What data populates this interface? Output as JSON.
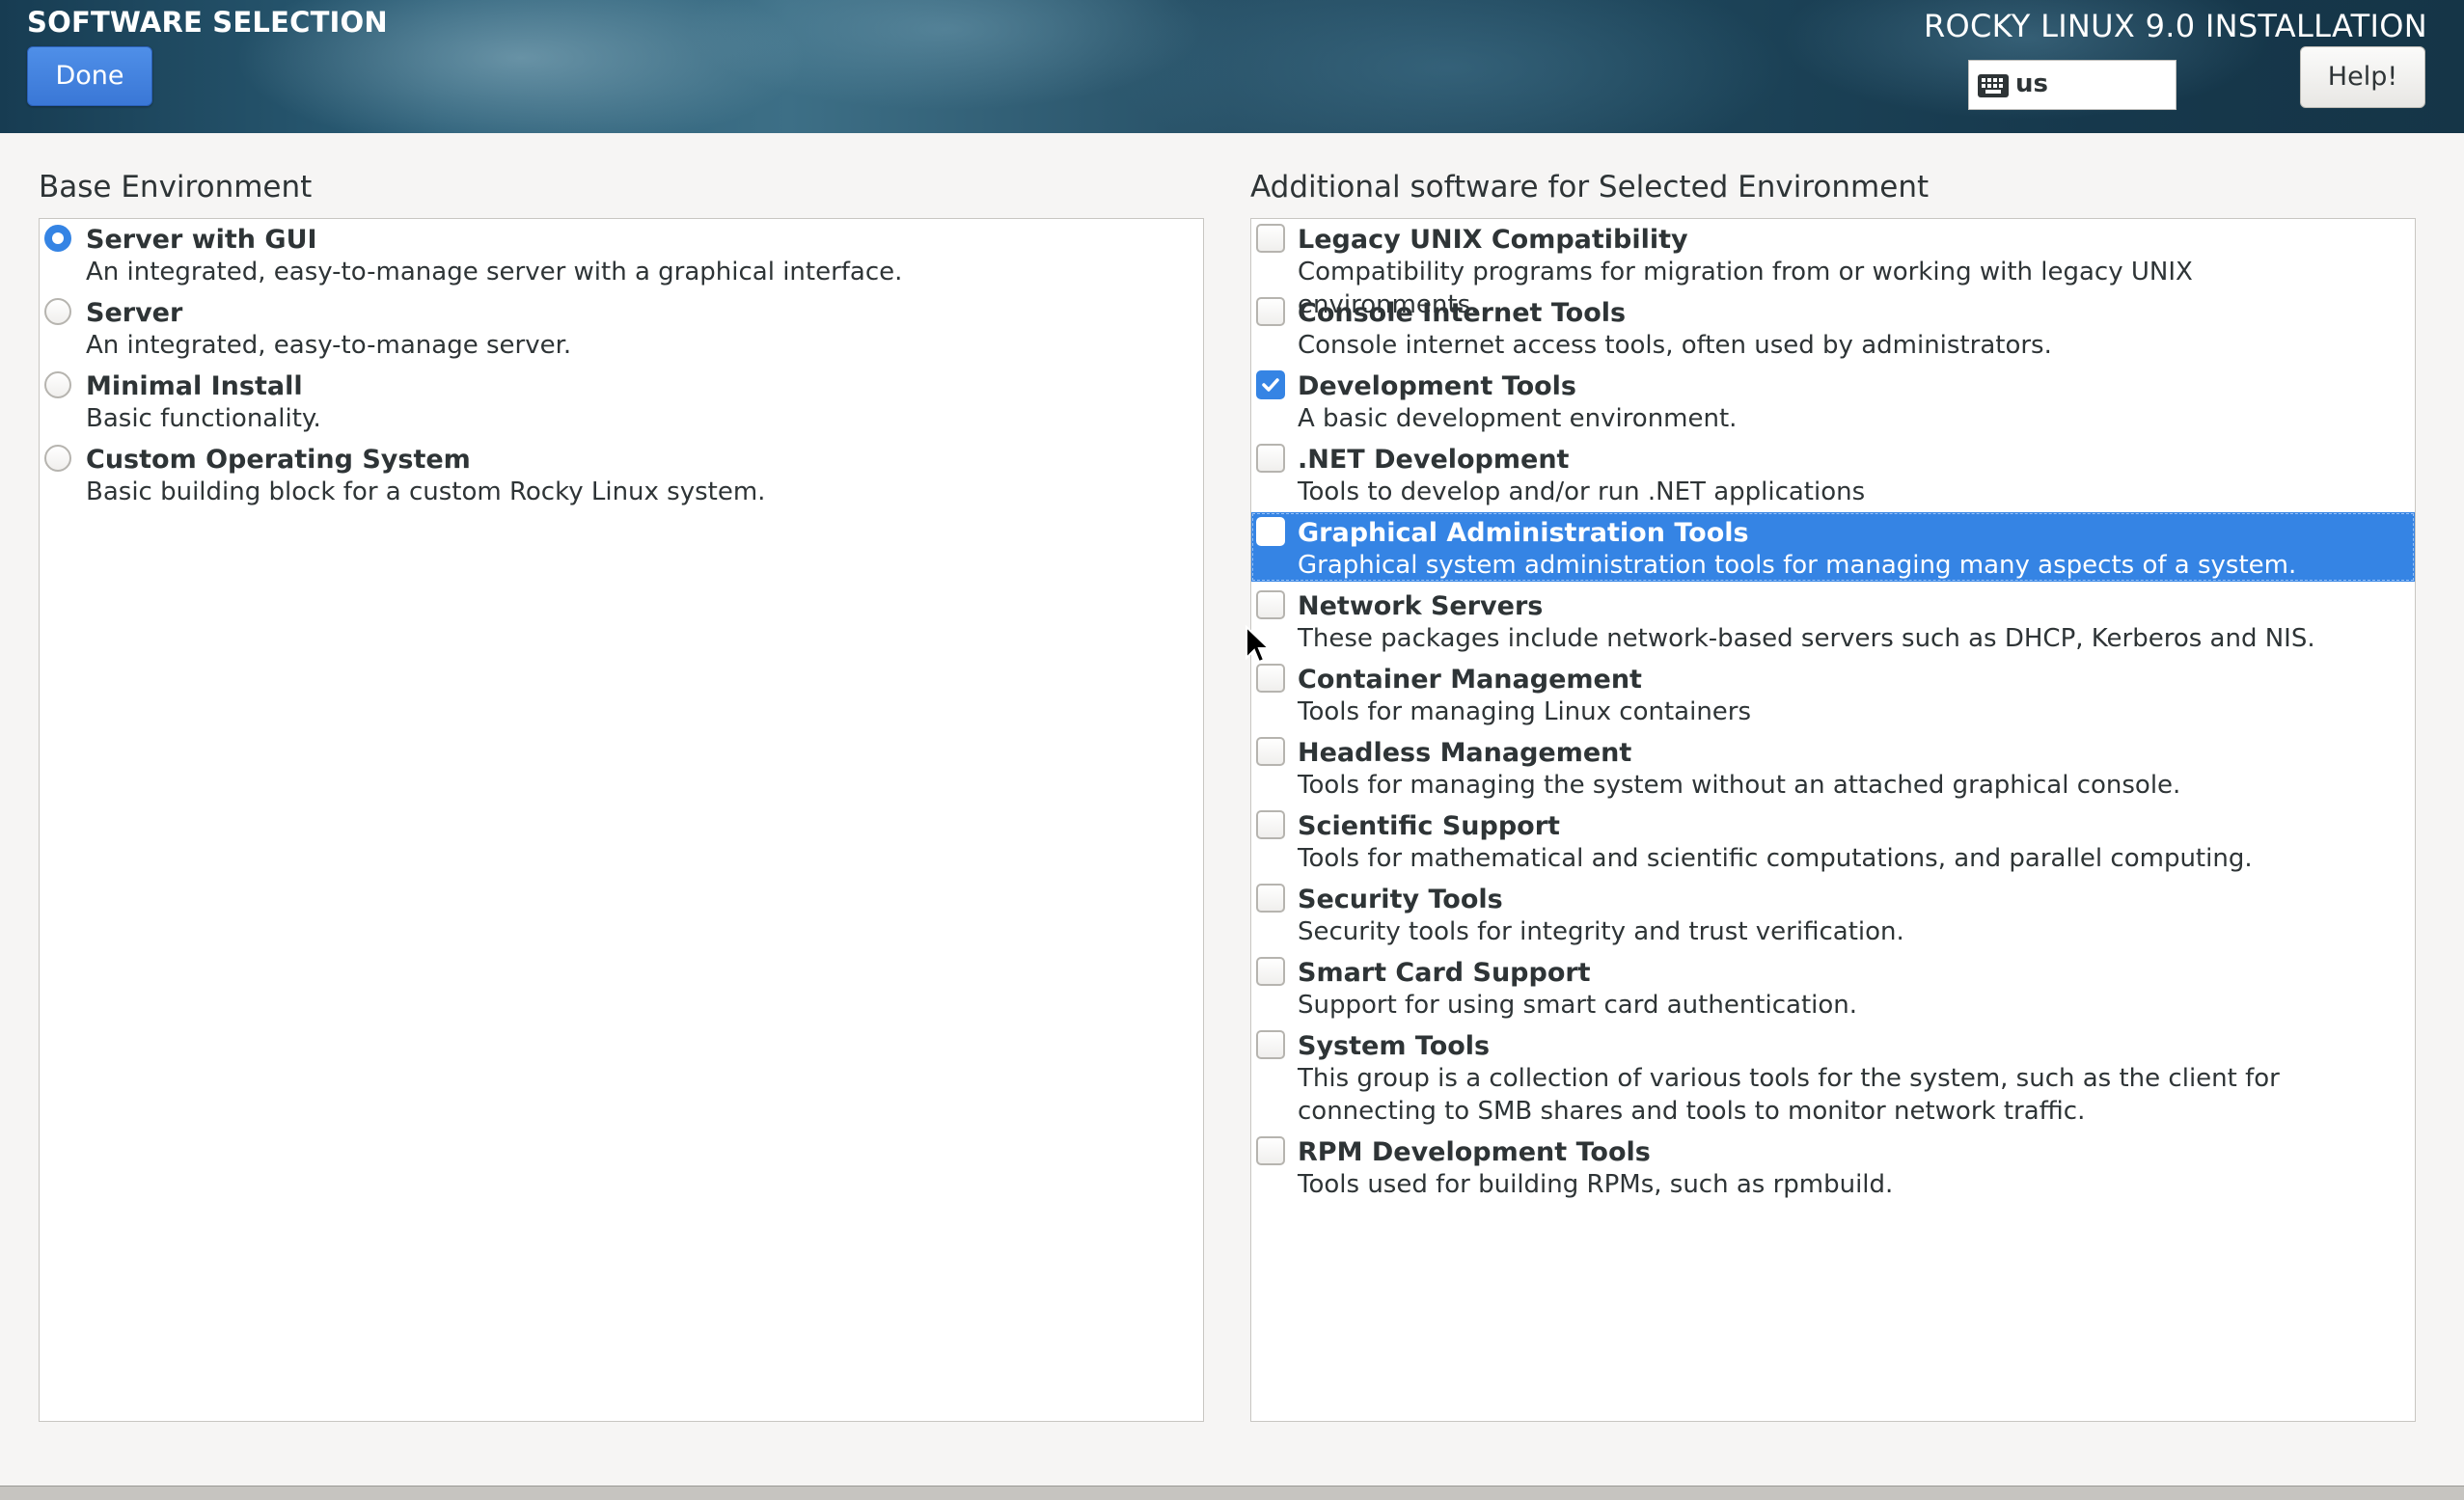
{
  "header": {
    "title": "SOFTWARE SELECTION",
    "done_label": "Done",
    "product": "ROCKY LINUX 9.0 INSTALLATION",
    "keyboard_layout": "us",
    "keyboard_icon": "keyboard-icon",
    "help_label": "Help!"
  },
  "base": {
    "heading": "Base Environment",
    "items": [
      {
        "name": "Server with GUI",
        "desc": "An integrated, easy-to-manage server with a graphical interface.",
        "selected": true
      },
      {
        "name": "Server",
        "desc": "An integrated, easy-to-manage server.",
        "selected": false
      },
      {
        "name": "Minimal Install",
        "desc": "Basic functionality.",
        "selected": false
      },
      {
        "name": "Custom Operating System",
        "desc": "Basic building block for a custom Rocky Linux system.",
        "selected": false
      }
    ]
  },
  "addons": {
    "heading": "Additional software for Selected Environment",
    "items": [
      {
        "name": "Legacy UNIX Compatibility",
        "desc": "Compatibility programs for migration from or working with legacy UNIX environments.",
        "checked": false
      },
      {
        "name": "Console Internet Tools",
        "desc": "Console internet access tools, often used by administrators.",
        "checked": false
      },
      {
        "name": "Development Tools",
        "desc": "A basic development environment.",
        "checked": true
      },
      {
        "name": ".NET Development",
        "desc": "Tools to develop and/or run .NET applications",
        "checked": false
      },
      {
        "name": "Graphical Administration Tools",
        "desc": "Graphical system administration tools for managing many aspects of a system.",
        "checked": false,
        "highlighted": true
      },
      {
        "name": "Network Servers",
        "desc": "These packages include network-based servers such as DHCP, Kerberos and NIS.",
        "checked": false
      },
      {
        "name": "Container Management",
        "desc": "Tools for managing Linux containers",
        "checked": false
      },
      {
        "name": "Headless Management",
        "desc": "Tools for managing the system without an attached graphical console.",
        "checked": false
      },
      {
        "name": "Scientific Support",
        "desc": "Tools for mathematical and scientific computations, and parallel computing.",
        "checked": false
      },
      {
        "name": "Security Tools",
        "desc": "Security tools for integrity and trust verification.",
        "checked": false
      },
      {
        "name": "Smart Card Support",
        "desc": "Support for using smart card authentication.",
        "checked": false
      },
      {
        "name": "System Tools",
        "desc": "This group is a collection of various tools for the system, such as the client for connecting to SMB shares and tools to monitor network traffic.",
        "checked": false
      },
      {
        "name": "RPM Development Tools",
        "desc": "Tools used for building RPMs, such as rpmbuild.",
        "checked": false
      }
    ]
  },
  "colors": {
    "accent": "#3584e4",
    "header_bg": "#1d4459",
    "panel_bg": "#ffffff",
    "window_bg": "#f6f5f4"
  }
}
